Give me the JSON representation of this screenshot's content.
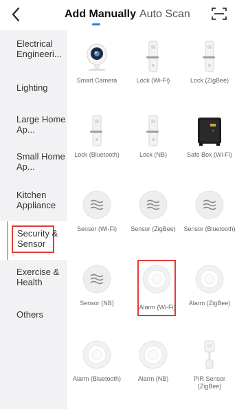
{
  "header": {
    "back_icon": "chevron-left-icon",
    "tabs": [
      {
        "label": "Add Manually",
        "active": true
      },
      {
        "label": "Auto Scan",
        "active": false
      }
    ],
    "scan_icon": "scan-frame-icon",
    "accent_color": "#2e7cf6"
  },
  "sidebar": {
    "items": [
      {
        "label": "Electrical Engineeri..."
      },
      {
        "label": "Lighting"
      },
      {
        "label": "Large Home Ap..."
      },
      {
        "label": "Small Home Ap..."
      },
      {
        "label": "Kitchen Appliance"
      },
      {
        "label": "Security & Sensor",
        "active": true
      },
      {
        "label": "Exercise & Health"
      },
      {
        "label": "Others"
      }
    ],
    "active_color": "#f5a623",
    "highlight_color": "#e53935"
  },
  "devices": [
    {
      "name": "Smart Camera",
      "icon": "smart-camera-icon"
    },
    {
      "name": "Lock (Wi-Fi)",
      "icon": "door-lock-icon"
    },
    {
      "name": "Lock (ZigBee)",
      "icon": "door-lock-icon"
    },
    {
      "name": "Lock (Bluetooth)",
      "icon": "door-lock-icon"
    },
    {
      "name": "Lock (NB)",
      "icon": "door-lock-icon"
    },
    {
      "name": "Safe Box (Wi-Fi)",
      "icon": "safe-box-icon"
    },
    {
      "name": "Sensor (Wi-Fi)",
      "icon": "sensor-icon"
    },
    {
      "name": "Sensor (ZigBee)",
      "icon": "sensor-icon"
    },
    {
      "name": "Sensor (Bluetooth)",
      "icon": "sensor-icon"
    },
    {
      "name": "Sensor (NB)",
      "icon": "sensor-icon"
    },
    {
      "name": "Alarm (Wi-Fi)",
      "icon": "smoke-alarm-icon",
      "highlighted": true
    },
    {
      "name": "Alarm (ZigBee)",
      "icon": "smoke-alarm-icon"
    },
    {
      "name": "Alarm (Bluetooth)",
      "icon": "smoke-alarm-icon"
    },
    {
      "name": "Alarm (NB)",
      "icon": "smoke-alarm-icon"
    },
    {
      "name": "PIR Sensor (ZigBee)",
      "icon": "pir-sensor-icon"
    }
  ]
}
